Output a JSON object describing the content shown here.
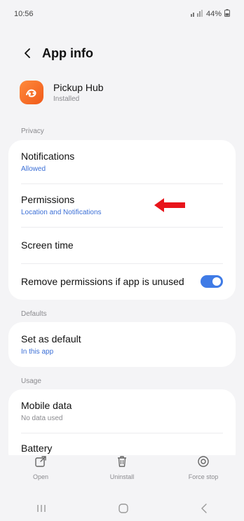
{
  "status_bar": {
    "time": "10:56",
    "signal": "📶",
    "battery": "44%"
  },
  "header": {
    "title": "App info"
  },
  "app": {
    "name": "Pickup Hub",
    "status": "Installed"
  },
  "sections": {
    "privacy": "Privacy",
    "defaults": "Defaults",
    "usage": "Usage"
  },
  "privacy_items": {
    "notifications": {
      "title": "Notifications",
      "sub": "Allowed"
    },
    "permissions": {
      "title": "Permissions",
      "sub": "Location and Notifications"
    },
    "screen_time": {
      "title": "Screen time"
    },
    "remove_permissions": {
      "title": "Remove permissions if app is unused",
      "toggle_on": true
    }
  },
  "defaults_items": {
    "set_default": {
      "title": "Set as default",
      "sub": "In this app"
    }
  },
  "usage_items": {
    "mobile_data": {
      "title": "Mobile data",
      "sub": "No data used"
    },
    "battery": {
      "title": "Battery"
    }
  },
  "actions": {
    "open": "Open",
    "uninstall": "Uninstall",
    "force_stop": "Force stop"
  },
  "colors": {
    "accent": "#3f7be6",
    "link": "#3b6fd6",
    "annotation_arrow": "#e8141a"
  }
}
